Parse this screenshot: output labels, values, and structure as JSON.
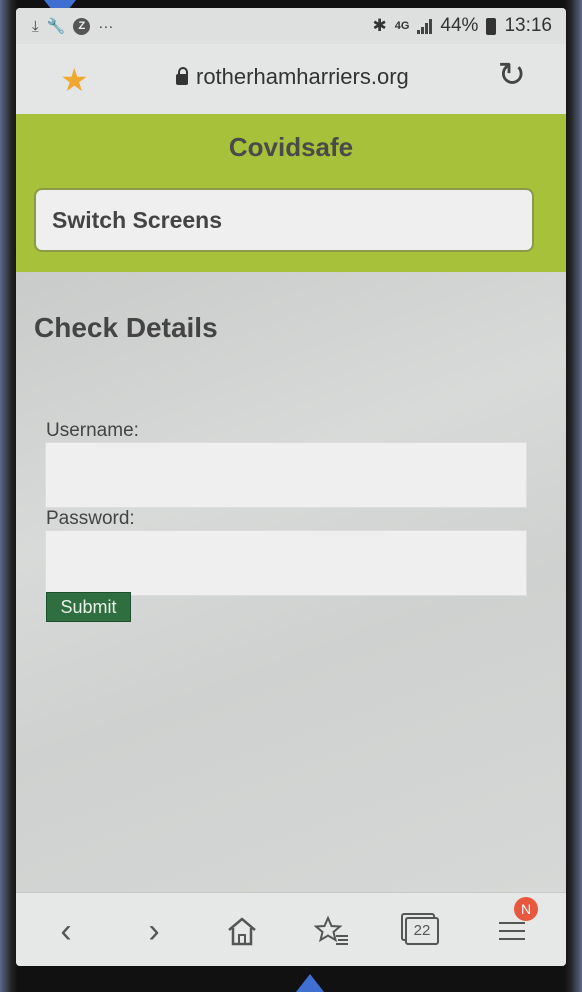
{
  "status_bar": {
    "more_indicator": "···",
    "z_badge": "Z",
    "network": "4G",
    "battery_percent": "44%",
    "time": "13:16"
  },
  "address_bar": {
    "url": "rotherhamharriers.org"
  },
  "header": {
    "title": "Covidsafe",
    "switch_button_label": "Switch Screens"
  },
  "form": {
    "heading": "Check Details",
    "username_label": "Username:",
    "username_value": "",
    "password_label": "Password:",
    "password_value": "",
    "submit_label": "Submit"
  },
  "bottom_nav": {
    "tabs_count": "22",
    "notification_badge": "N"
  },
  "colors": {
    "header_green": "#a7c13a",
    "submit_green": "#2f6e3e",
    "favorite_star": "#f0a830",
    "notification_badge": "#e8583e"
  }
}
